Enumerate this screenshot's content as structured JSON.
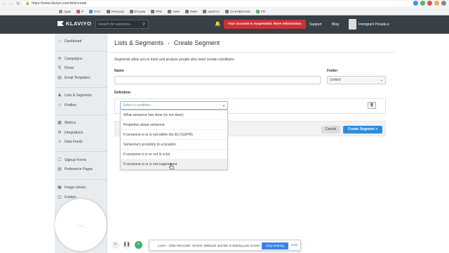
{
  "browser": {
    "url": "https://www.klaviyo.com/lists/create",
    "bookmarks": [
      "Apps",
      "P",
      "NYC",
      "Personal",
      "iPorada",
      "PPE",
      "AMH",
      "RMH",
      "awebYC",
      "DASHBOARD",
      "PR"
    ],
    "ext_colors": [
      "#4a90d9",
      "#5cb85c",
      "#d9534f",
      "#f0ad4e",
      "#888888"
    ]
  },
  "topnav": {
    "logo": "KLAVIYO",
    "search_placeholder": "Search for someone...",
    "alert": "Your account is suspended. More information.",
    "support": "Support",
    "blog": "Blog",
    "user": "Immigrant Porada"
  },
  "sidebar": {
    "items": [
      {
        "label": "Dashboard",
        "icon": "home-icon"
      },
      {
        "label": "Campaigns",
        "icon": "megaphone-icon"
      },
      {
        "label": "Flows",
        "icon": "flow-icon"
      },
      {
        "label": "Email Templates",
        "icon": "email-icon"
      },
      {
        "label": "Lists & Segments",
        "icon": "users-icon"
      },
      {
        "label": "Profiles",
        "icon": "person-icon"
      },
      {
        "label": "Metrics",
        "icon": "chart-icon"
      },
      {
        "label": "Integrations",
        "icon": "gear-icon"
      },
      {
        "label": "Data Feeds",
        "icon": "feed-icon"
      },
      {
        "label": "Signup Forms",
        "icon": "form-icon"
      },
      {
        "label": "Preference Pages",
        "icon": "page-icon"
      },
      {
        "label": "Image Library",
        "icon": "image-icon"
      },
      {
        "label": "Folders",
        "icon": "folder-icon"
      }
    ]
  },
  "main": {
    "breadcrumb_parent": "Lists & Segments",
    "breadcrumb_current": "Create Segment",
    "description": "Segments allow you to track and analyze people who meet certain conditions.",
    "name_label": "Name",
    "folder_label": "Folder",
    "folder_value": "Unfiled",
    "definition_label": "Definition",
    "condition_placeholder": "Select a condition...",
    "conditions": [
      "What someone has done (or not done)",
      "Properties about someone",
      "If someone is or is not within the EU (GDPR)",
      "Someone's proximity to a location",
      "If someone is in or not in a list",
      "If someone is or is not suppressed"
    ],
    "cancel": "Cancel",
    "create": "Create Segment »"
  },
  "loom": {
    "camera_dots": "...",
    "message": "Loom - Video Recorder: Screen, Webcam and Mic is sharing your screen.",
    "stop": "Stop sharing",
    "hide": "Hide"
  }
}
